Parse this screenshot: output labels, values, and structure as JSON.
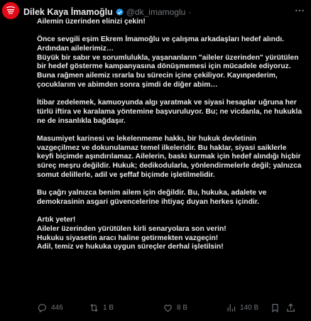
{
  "author": {
    "name": "Dilek Kaya İmamoğlu",
    "handle": "@dk_imamoglu",
    "separator": "·",
    "time": "",
    "avatar_color": "#e10a17"
  },
  "body_lines": [
    "Ailemin üzerinden elinizi çekin!",
    "",
    "Önce sevgili eşim Ekrem İmamoğlu ve çalışma arkadaşları hedef alındı.",
    "Ardından ailelerimiz…",
    "Büyük bir sabır ve sorumlulukla, yaşananların \"aileler üzerinden\" yürütülen",
    "bir hedef gösterme kampanyasına dönüşmemesi için mücadele ediyoruz.",
    "Buna rağmen ailemiz ısrarla bu sürecin içine çekiliyor. Kayınpederim,",
    "çocuklarım ve abimden sonra şimdi de diğer abim…",
    "",
    "İtibar zedelemek, kamuoyunda algı yaratmak ve siyasi hesaplar uğruna her",
    "türlü iftira ve karalama yöntemine başvuruluyor. Bu; ne vicdanla, ne hukukla",
    "ne de insanlıkla bağdaşır.",
    "",
    "Masumiyet karinesi ve lekelenmeme hakkı, bir hukuk devletinin",
    "vazgeçilmez ve dokunulamaz temel ilkeleridir. Bu haklar, siyasi saiklerle",
    "keyfi biçimde aşındırılamaz. Ailelerin, baskı kurmak için hedef alındığı hiçbir",
    "süreç meşru değildir. Hukuk; dedikodularla, yönlendirmelerle değil; yalnızca",
    "somut delillerle, adil ve şeffaf biçimde işletilmelidir.",
    "",
    "Bu çağrı yalnızca benim ailem için değildir. Bu, hukuka, adalete ve",
    "demokrasinin asgari güvencelerine ihtiyaç duyan herkes içindir.",
    "",
    "Artık yeter!",
    "Aileler üzerinden yürütülen kirli senaryolara son verin!",
    "Hukuku siyasetin aracı haline getirmekten vazgeçin!",
    "Adil, temiz ve hukuka uygun süreçler derhal işletilsin!"
  ],
  "actions": {
    "replies": "446",
    "reposts": "1 B",
    "likes": "8 B",
    "views": "140 B"
  },
  "colors": {
    "background": "#000000",
    "text": "#e7e9ea",
    "muted": "#71767b",
    "verified": "#1d9bf0"
  },
  "icons": [
    "avatar-logo",
    "verified-badge-icon",
    "more-icon",
    "reply-icon",
    "repost-icon",
    "like-icon",
    "views-icon",
    "bookmark-icon",
    "share-icon"
  ]
}
